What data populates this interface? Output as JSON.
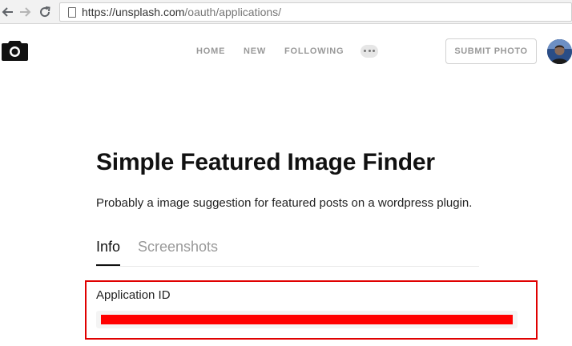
{
  "browser": {
    "url_host": "https://unsplash.com",
    "url_path": "/oauth/applications/",
    "back_icon": "arrow-left-icon",
    "forward_icon": "arrow-right-icon",
    "reload_icon": "reload-icon",
    "page_icon": "page-icon"
  },
  "header": {
    "logo_icon": "camera-icon",
    "nav": {
      "home": "HOME",
      "new": "NEW",
      "following": "FOLLOWING"
    },
    "more_icon": "ellipsis-icon",
    "submit_label": "SUBMIT PHOTO",
    "avatar": "user-avatar"
  },
  "main": {
    "title": "Simple Featured Image Finder",
    "description": "Probably a image suggestion for featured posts on a wordpress plugin.",
    "tabs": [
      {
        "label": "Info",
        "active": true
      },
      {
        "label": "Screenshots",
        "active": false
      }
    ],
    "application_id": {
      "label": "Application ID",
      "value_redacted": true
    }
  },
  "colors": {
    "accent_text": "#111111",
    "muted_text": "#999999",
    "highlight": "#e00000",
    "redaction": "#ff0000"
  }
}
